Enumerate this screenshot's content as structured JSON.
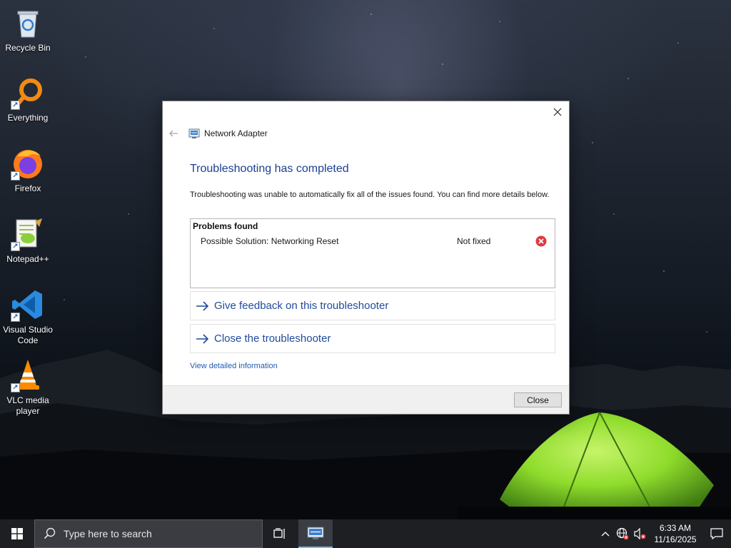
{
  "desktop": {
    "icons": [
      {
        "label": "Recycle Bin"
      },
      {
        "label": "Everything"
      },
      {
        "label": "Firefox"
      },
      {
        "label": "Notepad++"
      },
      {
        "label": "Visual Studio Code"
      },
      {
        "label": "VLC media player"
      }
    ]
  },
  "dialog": {
    "nav_title": "Network Adapter",
    "heading": "Troubleshooting has completed",
    "description": "Troubleshooting was unable to automatically fix all of the issues found. You can find more details below.",
    "problems": {
      "title": "Problems found",
      "items": [
        {
          "name": "Possible Solution: Networking Reset",
          "status": "Not fixed",
          "status_icon": "error-icon"
        }
      ]
    },
    "links": {
      "feedback": "Give feedback on this troubleshooter",
      "close_troubleshooter": "Close the troubleshooter",
      "details": "View detailed information"
    },
    "close_button": "Close"
  },
  "taskbar": {
    "search_placeholder": "Type here to search",
    "clock": {
      "time": "6:33 AM",
      "date": "11/16/2025"
    }
  },
  "colors": {
    "accent_blue": "#1c3f94",
    "link_blue": "#1f5cb3",
    "error_red": "#e0393e",
    "taskbar": "#1d1f23",
    "tent_green": "#8fdc2c"
  }
}
